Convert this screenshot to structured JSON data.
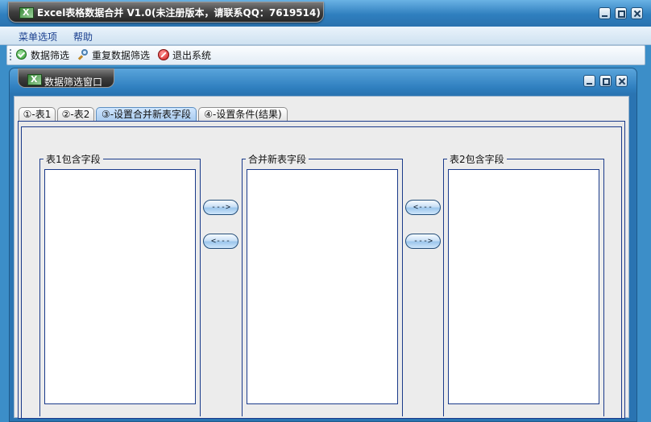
{
  "window": {
    "title": "Excel表格数据合并 V1.0(未注册版本，请联系QQ：7619514)"
  },
  "menu": {
    "items": [
      "菜单选项",
      "帮助"
    ]
  },
  "toolbar": {
    "filter_label": "数据筛选",
    "refilter_label": "重复数据筛选",
    "exit_label": "退出系统"
  },
  "inner_window": {
    "title": "数据筛选窗口"
  },
  "tabs": [
    {
      "label": "①-表1",
      "active": false
    },
    {
      "label": "②-表2",
      "active": false
    },
    {
      "label": "③-设置合并新表字段",
      "active": true
    },
    {
      "label": "④-设置条件(结果)",
      "active": false
    }
  ],
  "groups": {
    "table1": {
      "label": "表1包含字段"
    },
    "merged": {
      "label": "合并新表字段"
    },
    "table2": {
      "label": "表2包含字段"
    }
  },
  "buttons": {
    "left_add": "--->",
    "left_remove": "<---",
    "right_add": "<---",
    "right_remove": "--->"
  },
  "colors": {
    "title_bar": "#2f7fbf",
    "title_tab": "#3e3e3e",
    "menu_text": "#1a3f8f",
    "active_tab": "#a9cbef",
    "border_blue": "#1a3a8a"
  }
}
